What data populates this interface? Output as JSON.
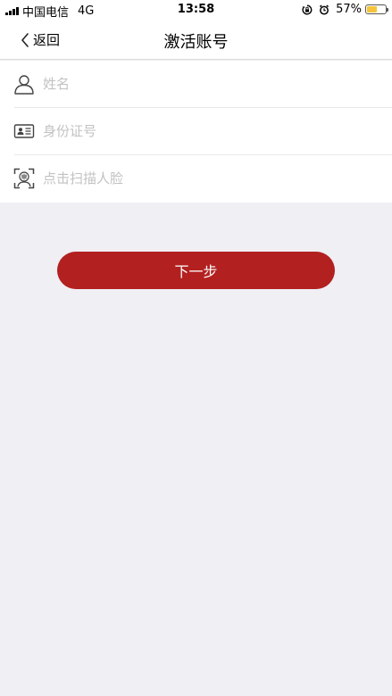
{
  "status_bar": {
    "carrier": "中国电信",
    "network": "4G",
    "time": "13:58",
    "battery": "57%",
    "battery_level": 0.57,
    "battery_color": "#f5c43a"
  },
  "nav": {
    "back_label": "返回",
    "title": "激活账号"
  },
  "form": {
    "name_placeholder": "姓名",
    "id_placeholder": "身份证号",
    "face_placeholder": "点击扫描人脸"
  },
  "actions": {
    "next_label": "下一步"
  },
  "colors": {
    "accent": "#b32020",
    "background": "#efeff4"
  }
}
